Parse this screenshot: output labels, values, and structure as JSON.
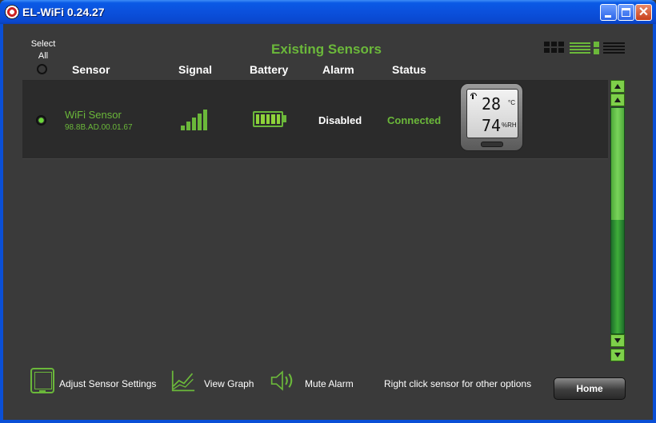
{
  "window": {
    "title": "EL-WiFi 0.24.27"
  },
  "header": {
    "section_title": "Existing Sensors",
    "select_all_line1": "Select",
    "select_all_line2": "All",
    "columns": {
      "sensor": "Sensor",
      "signal": "Signal",
      "battery": "Battery",
      "alarm": "Alarm",
      "status": "Status"
    },
    "view_modes": [
      "grid-view-icon",
      "list-view-icon",
      "detail-list-view-icon"
    ]
  },
  "sensors": [
    {
      "name": "WiFi Sensor",
      "mac": "98.8B.AD.00.01.67",
      "signal_bars": 5,
      "signal_bars_max": 5,
      "battery_level": 1.0,
      "alarm": "Disabled",
      "status": "Connected",
      "display": {
        "temperature": "28",
        "temperature_unit": "°C",
        "humidity": "74",
        "humidity_unit": "%RH"
      }
    }
  ],
  "footer": {
    "adjust_settings": "Adjust Sensor Settings",
    "view_graph": "View Graph",
    "mute_alarm": "Mute Alarm",
    "hint": "Right click sensor for other options",
    "home": "Home"
  },
  "colors": {
    "accent_green": "#6bb83a",
    "background": "#3a3a3a",
    "row_background": "#2b2b2b",
    "title_bar_blue": "#0b50dc"
  }
}
